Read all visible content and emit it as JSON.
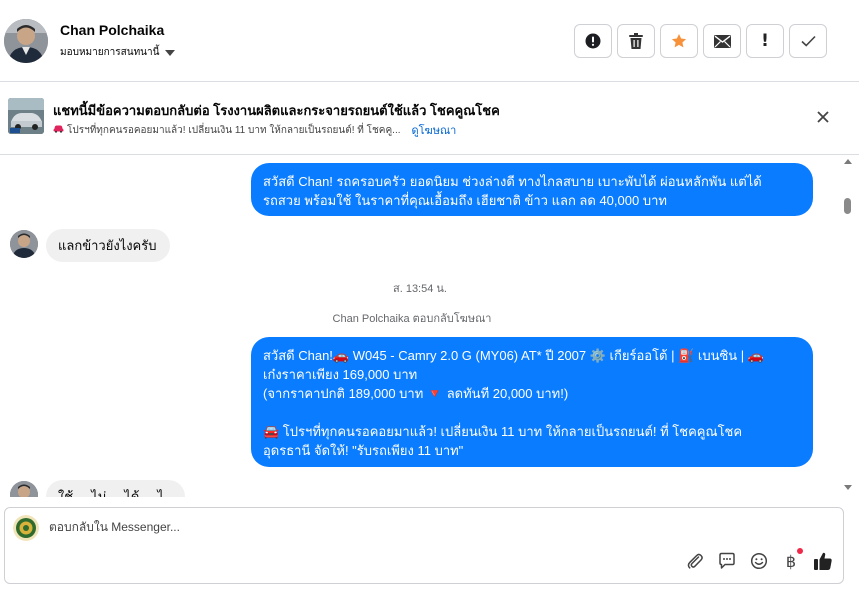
{
  "header": {
    "contact_name": "Chan Polchaika",
    "assignment": "มอบหมายการสนทนานี้",
    "actions": [
      {
        "icon": "alert-circle-icon",
        "label": "Mark as spam"
      },
      {
        "icon": "trash-icon",
        "label": "Delete"
      },
      {
        "icon": "star-icon",
        "label": "Star"
      },
      {
        "icon": "envelope-icon",
        "label": "Mark unread"
      },
      {
        "icon": "exclamation-icon",
        "label": "!"
      },
      {
        "icon": "check-icon",
        "label": "Done"
      }
    ],
    "colors": {
      "star": "#f7923a"
    }
  },
  "ad_banner": {
    "title": "แชทนี้มีข้อความตอบกลับต่อ โรงงานผลิตและกระจายรถยนต์ใช้แล้ว โชคคูณโชค",
    "subtitle": "โปรฯที่ทุกคนรอคอยมาแล้ว! เปลี่ยนเงิน 11 บาท ให้กลายเป็นรถยนต์! ที่ โชคคู...",
    "link": "ดูโฆษณา"
  },
  "messages": {
    "out_1": [
      "สวัสดี Chan! รถครอบครัว ยอดนิยม ช่วงล่างดี ทางไกลสบาย เบาะพับได้ ผ่อนหลักพัน แต่ได้",
      "รถสวย พร้อมใช้ ในราคาที่คุณเอื้อมถึง เฮียชาติ ข้าว แลก ลด 40,000 บาท"
    ],
    "in_1": "แลกข้าวยังไงครับ",
    "timestamp": "ส. 13:54 น.",
    "reply_note": "Chan Polchaika ตอบกลับโฆษณา",
    "out_2": [
      "สวัสดี Chan!🚗 W045 - Camry 2.0 G (MY06) AT* ปี 2007 ⚙️ เกียร์ออโต้ | ⛽ เบนซิน | 🚗",
      "เก๋งราคาเพียง 169,000 บาท",
      "(จากราคาปกติ 189,000 บาท 🔻 ลดทันที 20,000 บาท!)",
      "",
      "🚘 โปรฯที่ทุกคนรอคอยมาแล้ว! เปลี่ยนเงิน 11 บาท ให้กลายเป็นรถยนต์! ที่ โชคคูณโชค",
      "อุดรธานี จัดให้! \"รับรถเพียง 11 บาท\""
    ],
    "in_2_partial": "ใช้ ... ไม่ ... ได้ ... ไ",
    "colors": {
      "outgoing": "#0a7cff",
      "incoming": "#f0f0f0"
    }
  },
  "composer": {
    "placeholder": "ตอบกลับใน Messenger...",
    "tools": [
      "paperclip-icon",
      "chat-bubble-icon",
      "emoji-icon",
      "baht-icon",
      "thumbs-up-icon"
    ],
    "baht_symbol": "฿"
  }
}
